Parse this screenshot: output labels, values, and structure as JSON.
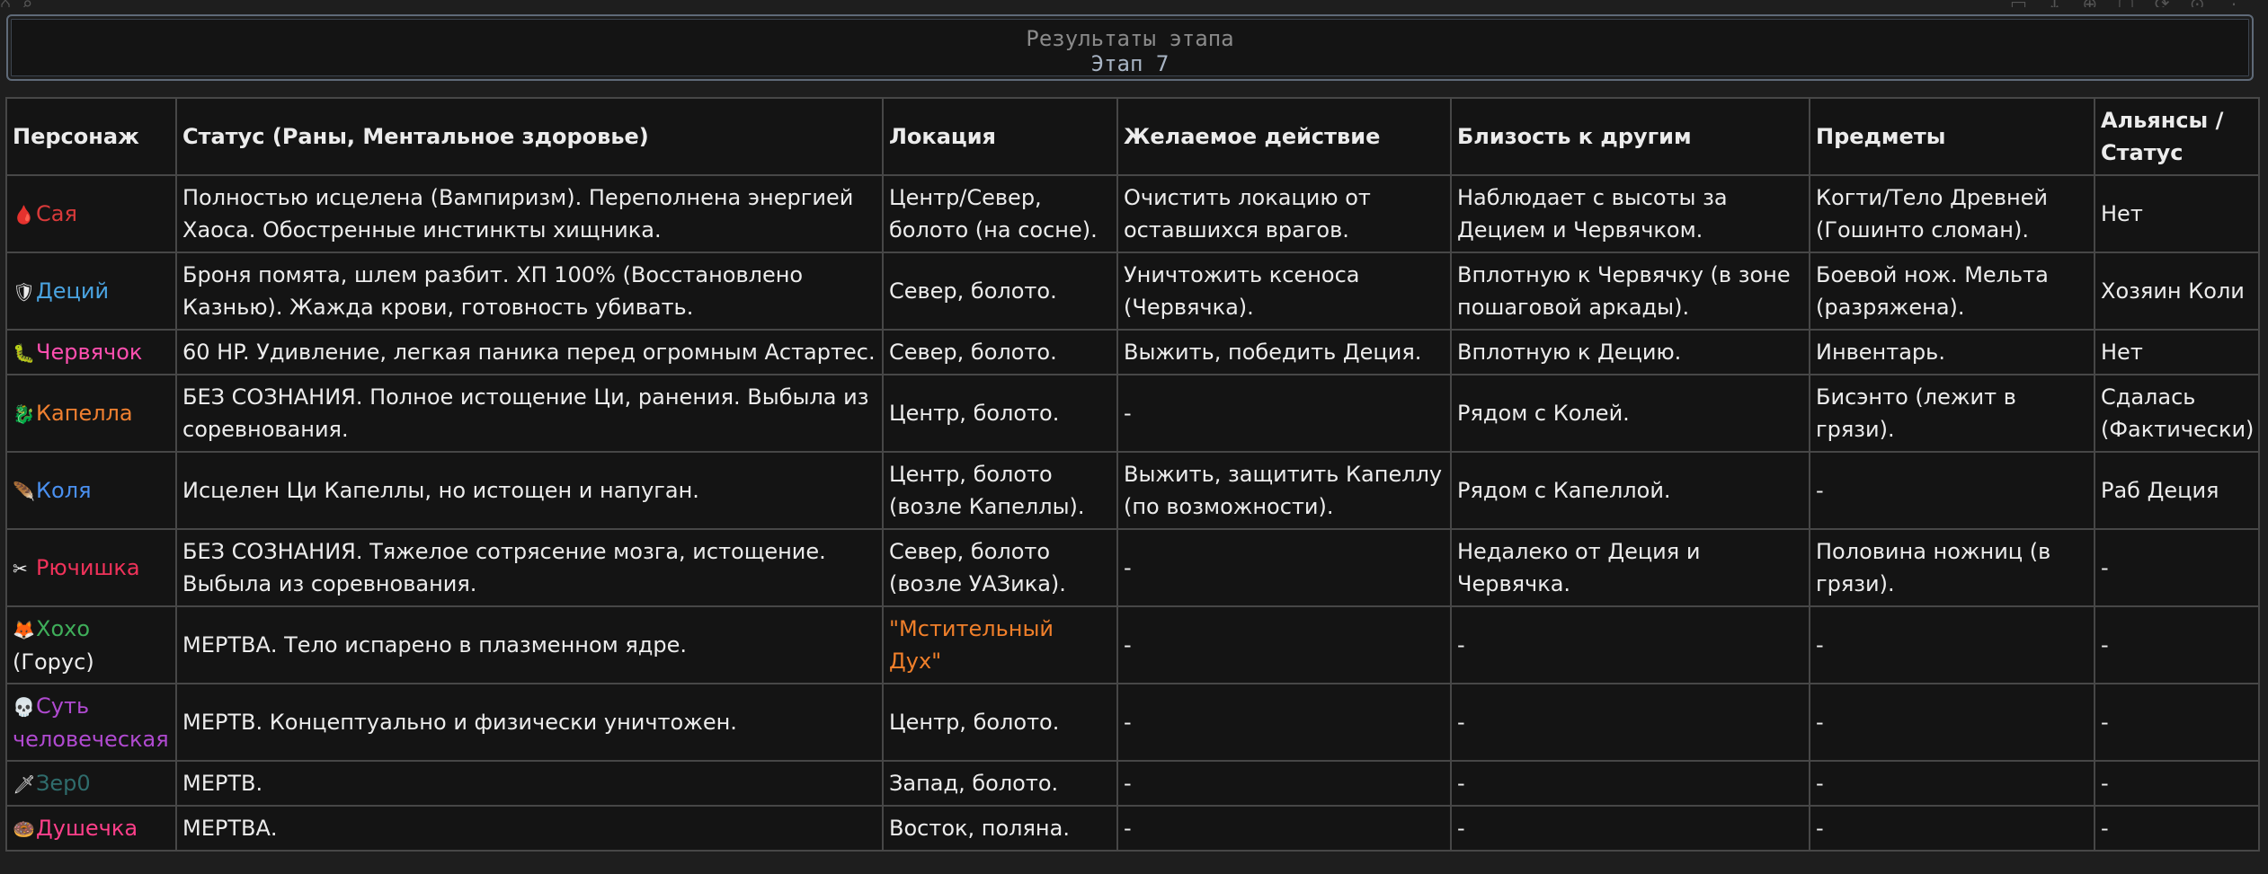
{
  "panel": {
    "title": "Результаты этапа",
    "subtitle": "Этап 7"
  },
  "table": {
    "columns": [
      "Персонаж",
      "Статус (Раны, Ментальное здоровье)",
      "Локация",
      "Желаемое действие",
      "Близость к другим",
      "Предметы",
      "Альянсы / Статус"
    ],
    "rows": [
      {
        "icon": "blood-drop-icon",
        "glyph": "🩸",
        "name": "Сая",
        "name_color": "#d93a3a",
        "status": "Полностью исцелена (Вампиризм). Переполнена энергией Хаоса. Обостренные инстинкты хищника.",
        "location": "Центр/Север, болото (на сосне).",
        "action": "Очистить локацию от оставшихся врагов.",
        "proximity": "Наблюдает с высоты за Децием и Червячком.",
        "items": "Когти/Тело Древней (Гошинто сломан).",
        "alliance": "Нет"
      },
      {
        "icon": "shield-icon",
        "glyph": "🛡",
        "name": "Деций",
        "name_color": "#4aa3e0",
        "status": "Броня помята, шлем разбит. ХП 100% (Восстановлено Казнью). Жажда крови, готовность убивать.",
        "location": "Север, болото.",
        "action": "Уничтожить ксеноса (Червячка).",
        "proximity": "Вплотную к Червячку (в зоне пошаговой аркады).",
        "items": "Боевой нож. Мельта (разряжена).",
        "alliance": "Хозяин Коли"
      },
      {
        "icon": "worm-icon",
        "glyph": "🐛",
        "name": "Червячок",
        "name_color": "#ff4fb0",
        "status": "60 HP. Удивление, легкая паника перед огромным Астартес.",
        "location": "Север, болото.",
        "action": "Выжить, победить Деция.",
        "proximity": "Вплотную к Децию.",
        "items": "Инвентарь.",
        "alliance": "Нет"
      },
      {
        "icon": "dragon-icon",
        "glyph": "🐉",
        "name": "Капелла",
        "name_color": "#f08030",
        "status": "БЕЗ СОЗНАНИЯ. Полное истощение Ци, ранения. Выбыла из соревнования.",
        "location": "Центр, болото.",
        "action": "-",
        "proximity": "Рядом с Колей.",
        "items": "Бисэнто (лежит в грязи).",
        "alliance": "Сдалась (Фактически)"
      },
      {
        "icon": "feather-icon",
        "glyph": "🪶",
        "name": "Коля",
        "name_color": "#4a90f0",
        "status": "Исцелен Ци Капеллы, но истощен и напуган.",
        "location": "Центр, болото (возле Капеллы).",
        "action": "Выжить, защитить Капеллу (по возможности).",
        "proximity": "Рядом с Капеллой.",
        "items": "-",
        "alliance": "Раб Деция"
      },
      {
        "icon": "scissors-icon",
        "glyph": "✂",
        "name": "Рючишка",
        "name_color": "#f0325a",
        "status": "БЕЗ СОЗНАНИЯ. Тяжелое сотрясение мозга, истощение. Выбыла из соревнования.",
        "location": "Север, болото (возле УАЗика).",
        "action": "-",
        "proximity": "Недалеко от Деция и Червячка.",
        "items": "Половина ножниц (в грязи).",
        "alliance": "-"
      },
      {
        "icon": "fox-icon",
        "glyph": "🦊",
        "name": "Хохо",
        "name_color": "#3fae5a",
        "name_suffix": "(Горус)",
        "status": "МЕРТВА. Тело испарено в плазменном ядре.",
        "location": "\"Мстительный Дух\"",
        "location_highlight": true,
        "action": "-",
        "proximity": "-",
        "items": "-",
        "alliance": "-"
      },
      {
        "icon": "skull-icon",
        "glyph": "💀",
        "name": "Суть человеческая",
        "name_color": "#b04ad0",
        "status": "МЕРТВ. Концептуально и физически уничтожен.",
        "location": "Центр, болото.",
        "action": "-",
        "proximity": "-",
        "items": "-",
        "alliance": "-"
      },
      {
        "icon": "dagger-icon",
        "glyph": "🗡",
        "name": "Зер0",
        "name_color": "#2f6c6c",
        "status": "МЕРТВ.",
        "location": "Запад, болото.",
        "action": "-",
        "proximity": "-",
        "items": "-",
        "alliance": "-"
      },
      {
        "icon": "donut-icon",
        "glyph": "🍩",
        "name": "Душечка",
        "name_color": "#ff3f8a",
        "status": "МЕРТВА.",
        "location": "Восток, поляна.",
        "action": "-",
        "proximity": "-",
        "items": "-",
        "alliance": "-"
      }
    ]
  }
}
